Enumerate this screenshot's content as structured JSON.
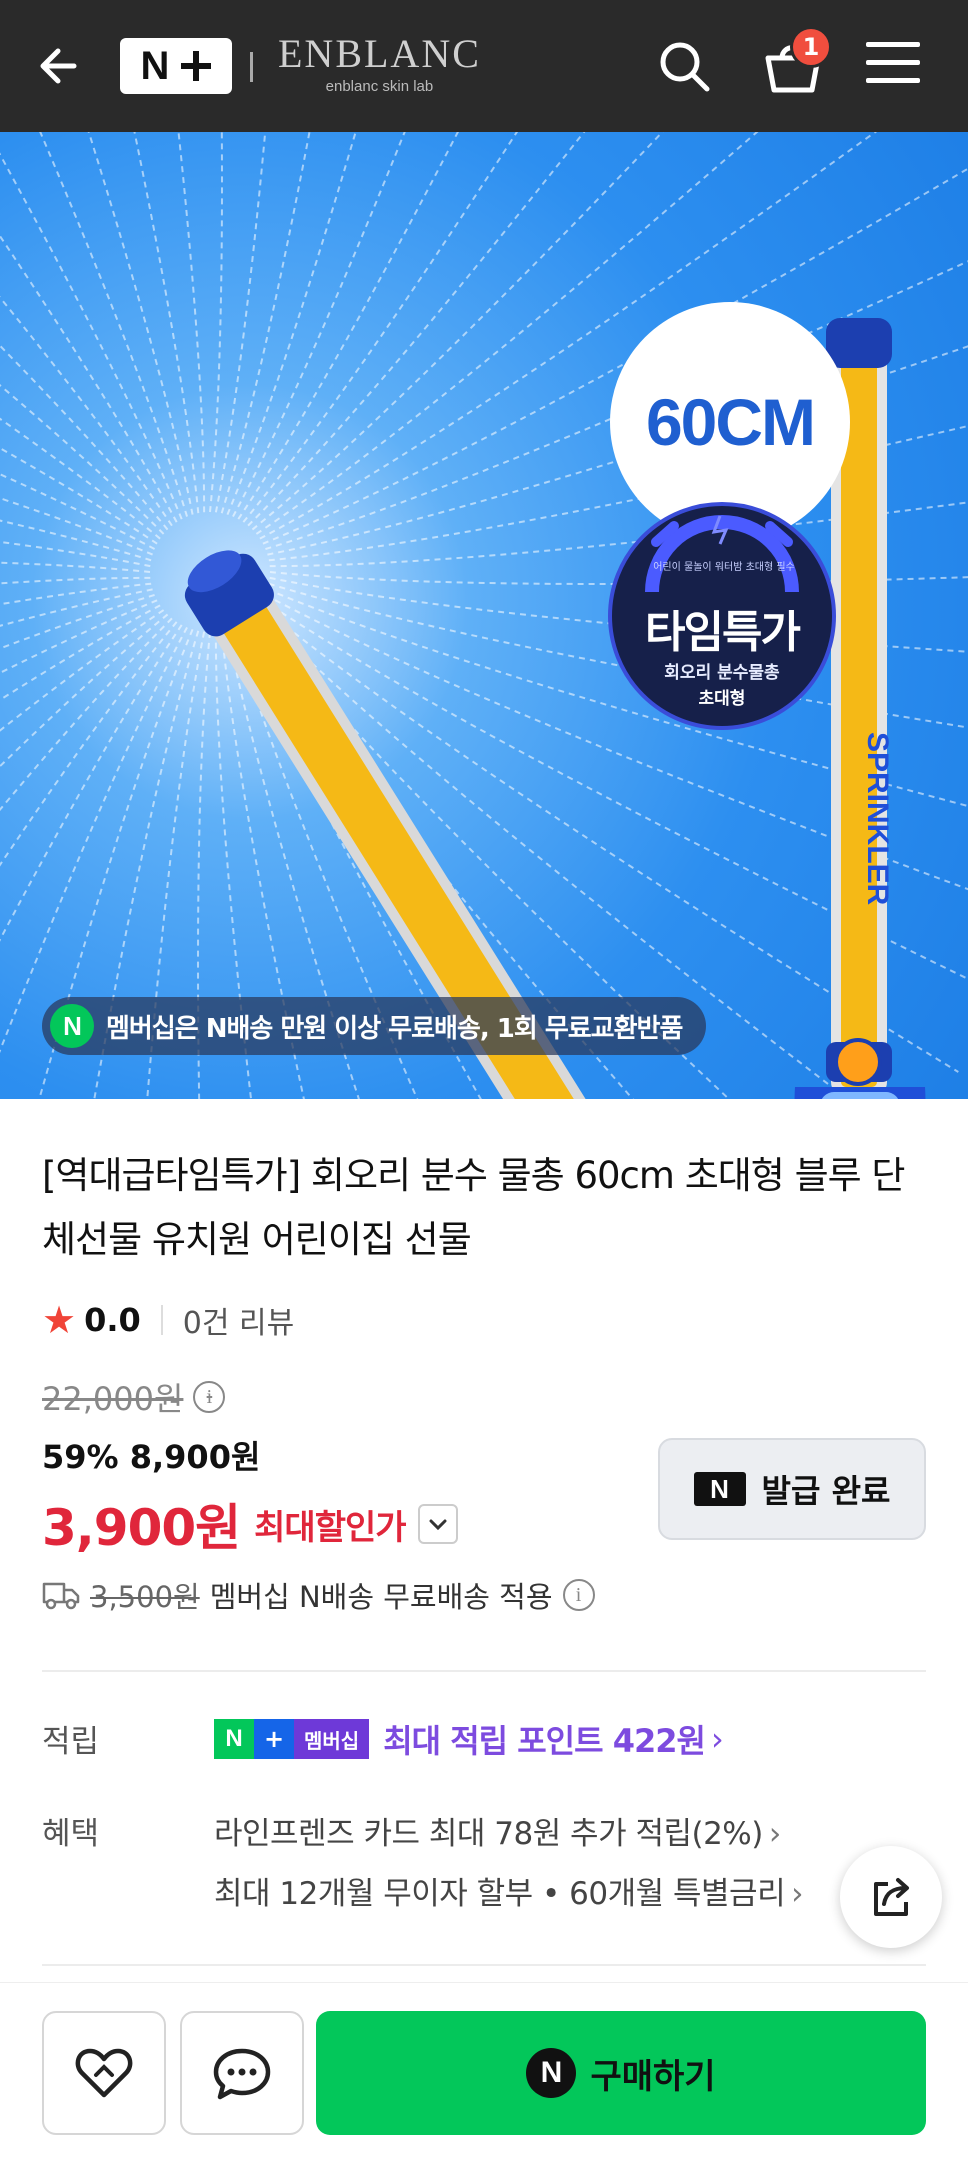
{
  "header": {
    "logo_n": "N",
    "brand_name": "ENBLANC",
    "brand_sub": "enblanc skin lab",
    "cart_count": "1"
  },
  "hero": {
    "size_badge": "60CM",
    "time_badge_arc": "어린이 물놀이 워터밤 초대형 필수",
    "time_badge_main": "타임특가",
    "time_badge_sub1": "회오리 분수물총",
    "time_badge_sub2": "초대형",
    "membership_icon": "N",
    "membership_notice": "멤버십은 N배송 만원 이상 무료배송, 1회 무료교환반품",
    "colors": {
      "background": "#2d8ff0",
      "tube": "#f5b916",
      "cap": "#1c3fb0"
    }
  },
  "product": {
    "title": "[역대급타임특가] 회오리 분수 물총 60cm 초대형 블루 단체선물 유치원 어린이집 선물",
    "rating_score": "0.0",
    "review_count": "0건 리뷰",
    "original_price": "22,000원",
    "discount_price": "59% 8,900원",
    "max_discount_value": "3,900원",
    "max_discount_label": "최대할인가",
    "coupon_icon": "N",
    "coupon_status": "발급 완료",
    "shipping_old": "3,500원",
    "shipping_text": "멤버십 N배송 무료배송 적용"
  },
  "points": {
    "label": "적립",
    "tag_n": "N",
    "tag_plus": "+",
    "tag_member": "멤버십",
    "text": "최대 적립 포인트 422원"
  },
  "benefits": {
    "label": "혜택",
    "line1": "라인프렌즈 카드 최대 78원 추가 적립(2%)",
    "line2": "최대 12개월 무이자 할부 • 60개월 특별금리"
  },
  "bottom": {
    "buy_icon": "N",
    "buy_label": "구매하기",
    "accent": "#03c75a"
  }
}
